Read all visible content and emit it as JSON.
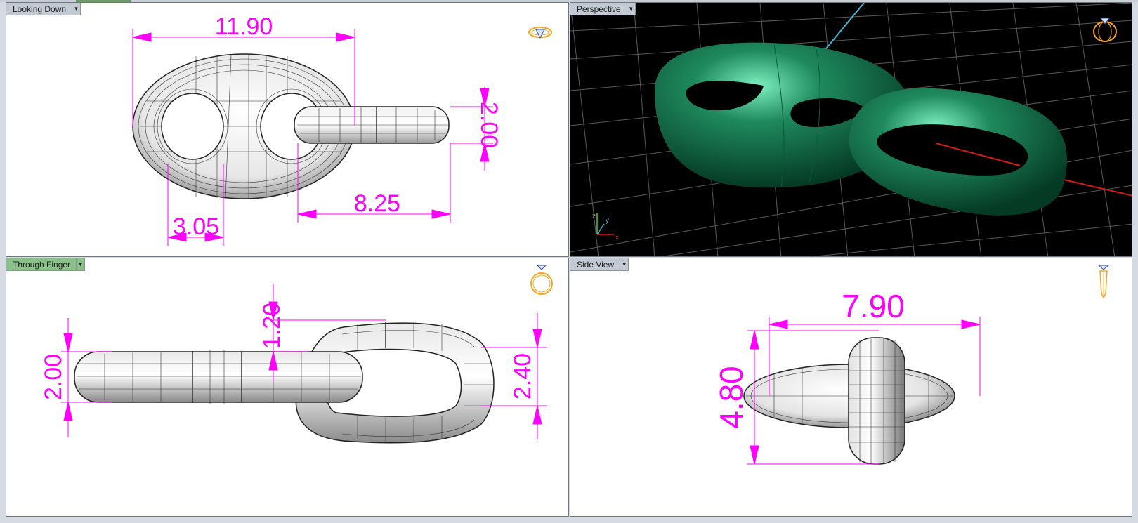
{
  "viewports": {
    "top": {
      "label": "Looking Down",
      "dimensions": {
        "width": "11.90",
        "link_height": "2.00",
        "link_length": "8.25",
        "hole": "3.05"
      }
    },
    "perspective": {
      "label": "Perspective",
      "axes": {
        "z": "z",
        "y": "y",
        "x": "x"
      }
    },
    "front": {
      "label": "Through Finger",
      "dimensions": {
        "thickness_left": "2.00",
        "wire": "1.20",
        "link_height": "2.40"
      }
    },
    "side": {
      "label": "Side View",
      "dimensions": {
        "width": "7.90",
        "height": "4.80"
      }
    }
  },
  "icons": {
    "top_gizmo": "ring-top-view-icon",
    "perspective_gizmo": "ring-perspective-icon",
    "front_gizmo": "ring-front-view-icon",
    "side_gizmo": "ring-side-view-icon",
    "dropdown": "chevron-down-icon"
  },
  "colors": {
    "dimension": "#ff00ff",
    "model_green": "#1f8a5e",
    "gizmo": "#f5a623",
    "active_tab": "#8bc08b"
  }
}
